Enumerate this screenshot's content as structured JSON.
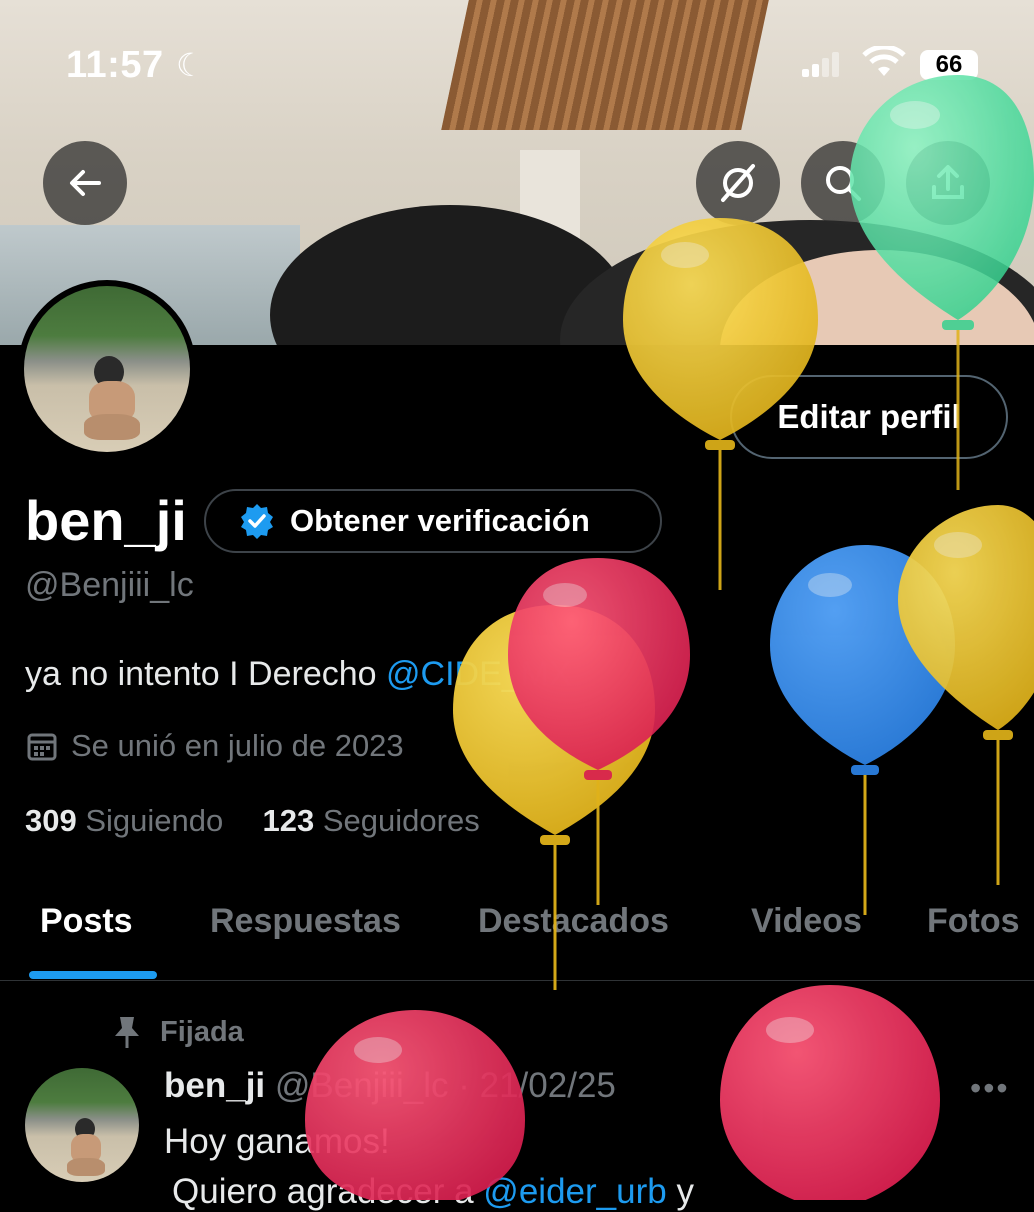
{
  "status_bar": {
    "time": "11:57",
    "battery": "66"
  },
  "profile": {
    "edit_label": "Editar perfil",
    "display_name": "ben_ji",
    "verify_label": "Obtener verificación",
    "handle": "@Benjiii_lc",
    "bio_text": "ya no intento I Derecho ",
    "bio_mention": "@CIDE_MX",
    "joined": "Se unió en julio de 2023",
    "following_count": "309",
    "following_label": "Siguiendo",
    "followers_count": "123",
    "followers_label": "Seguidores"
  },
  "tabs": [
    "Posts",
    "Respuestas",
    "Destacados",
    "Videos",
    "Fotos"
  ],
  "post": {
    "pinned_label": "Fijada",
    "author": "ben_ji",
    "meta": "@Benjiii_lc · 21/02/25",
    "line1": "Hoy ganamos!",
    "line2_prefix": " Quiero agradecer a ",
    "line2_mention": "@eider_urb",
    "line2_suffix": " y"
  },
  "colors": {
    "accent": "#1d9bf0",
    "muted": "#71767b",
    "background": "#000000"
  },
  "icons": [
    "back-arrow-icon",
    "grok-icon",
    "search-icon",
    "share-icon",
    "verified-badge-icon",
    "calendar-icon",
    "pin-icon",
    "more-icon",
    "moon-icon",
    "signal-icon",
    "wifi-icon",
    "battery-icon"
  ]
}
